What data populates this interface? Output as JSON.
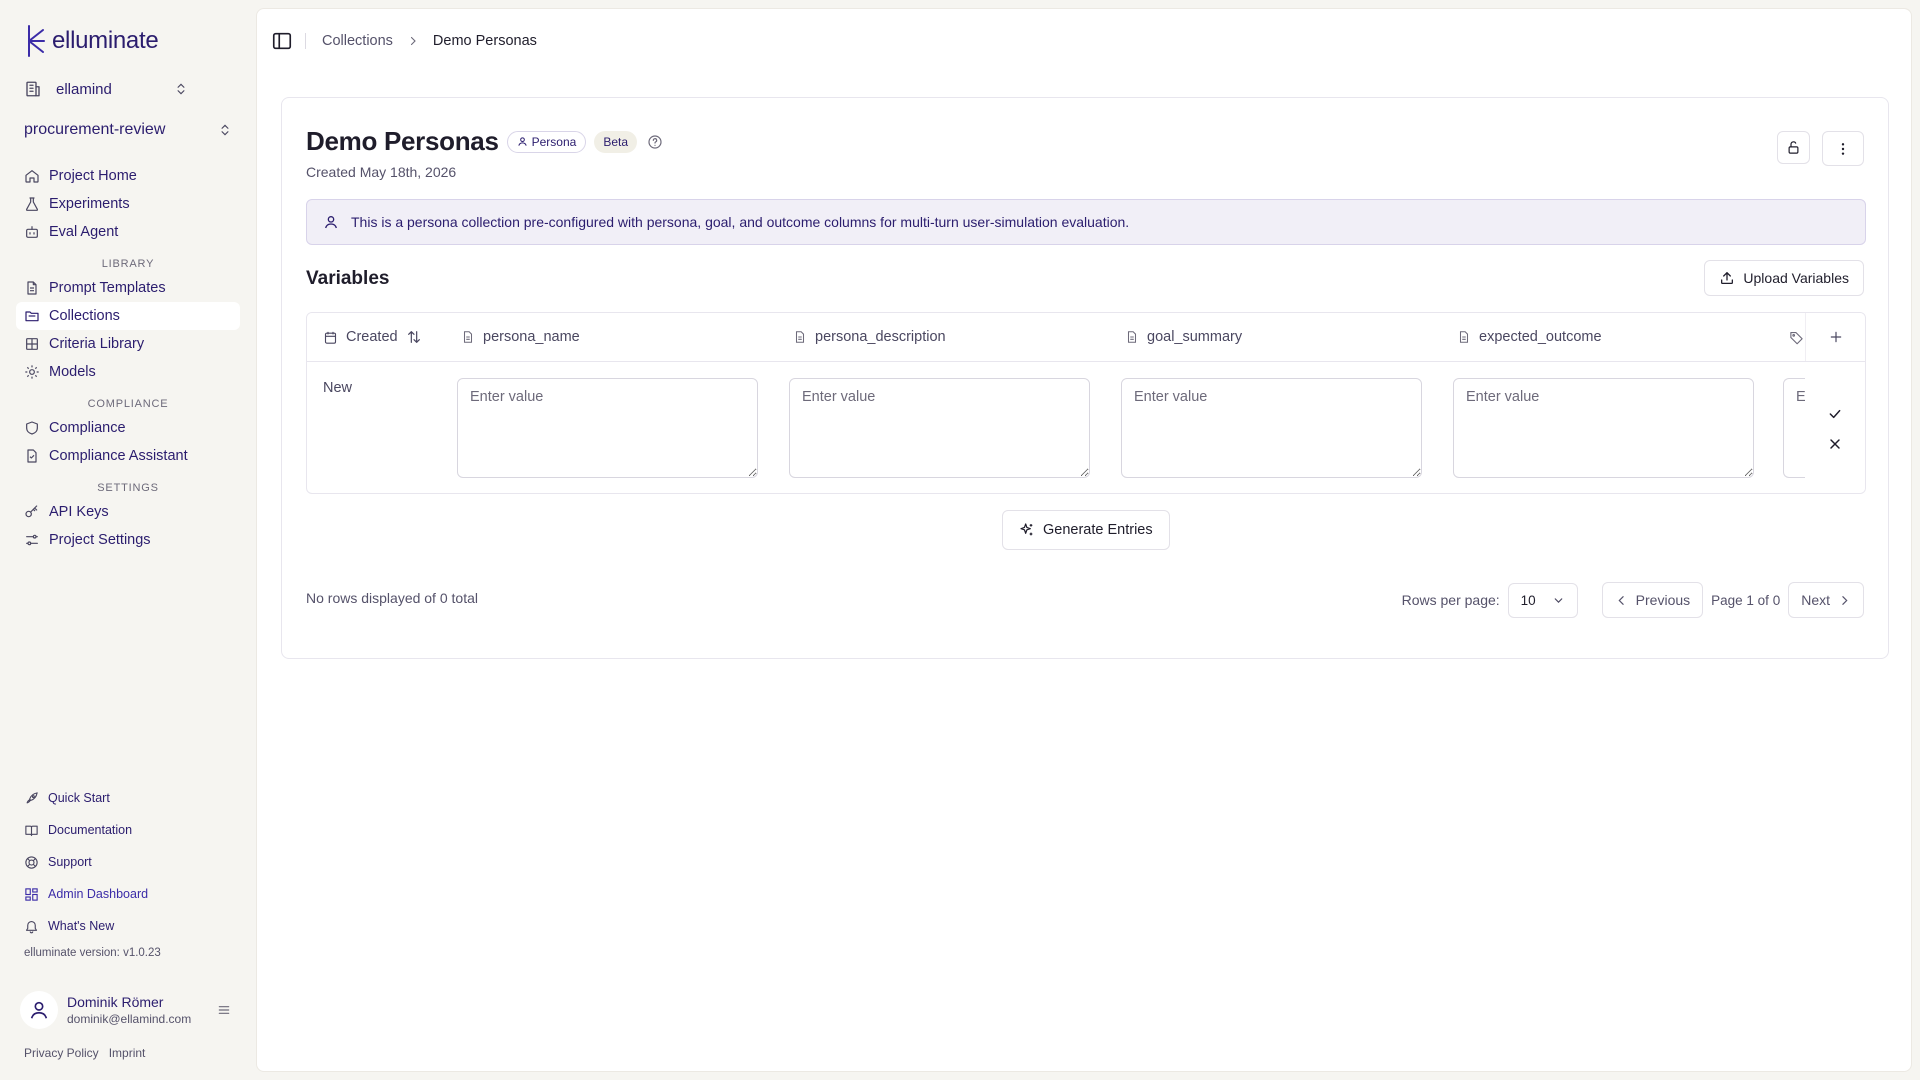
{
  "app": {
    "name": "elluminate",
    "version_text": "elluminate version: v1.0.23"
  },
  "org": {
    "name": "ellamind"
  },
  "project": {
    "name": "procurement-review"
  },
  "nav": {
    "main": [
      {
        "label": "Project Home",
        "icon": "home-icon"
      },
      {
        "label": "Experiments",
        "icon": "flask-icon"
      },
      {
        "label": "Eval Agent",
        "icon": "bot-icon"
      }
    ],
    "library_title": "LIBRARY",
    "library": [
      {
        "label": "Prompt Templates",
        "icon": "file-icon"
      },
      {
        "label": "Collections",
        "icon": "folder-icon",
        "active": true
      },
      {
        "label": "Criteria Library",
        "icon": "library-icon"
      },
      {
        "label": "Models",
        "icon": "cog-icon"
      }
    ],
    "compliance_title": "COMPLIANCE",
    "compliance": [
      {
        "label": "Compliance",
        "icon": "shield-icon"
      },
      {
        "label": "Compliance Assistant",
        "icon": "file-check-icon"
      }
    ],
    "settings_title": "SETTINGS",
    "settings": [
      {
        "label": "API Keys",
        "icon": "key-icon"
      },
      {
        "label": "Project Settings",
        "icon": "sliders-icon"
      }
    ]
  },
  "footer_nav": [
    {
      "label": "Quick Start",
      "icon": "rocket-icon"
    },
    {
      "label": "Documentation",
      "icon": "book-icon"
    },
    {
      "label": "Support",
      "icon": "lifebuoy-icon"
    },
    {
      "label": "Admin Dashboard",
      "icon": "grid-icon"
    },
    {
      "label": "What's New",
      "icon": "bell-icon"
    }
  ],
  "user": {
    "name": "Dominik Römer",
    "email": "dominik@ellamind.com"
  },
  "legal": {
    "privacy": "Privacy Policy",
    "imprint": "Imprint"
  },
  "breadcrumb": {
    "parent": "Collections",
    "current": "Demo Personas"
  },
  "collection": {
    "title": "Demo Personas",
    "type_badge": "Persona",
    "beta_badge": "Beta",
    "created": "Created May 18th, 2026",
    "info": "This is a persona collection pre-configured with persona, goal, and outcome columns for multi-turn user-simulation evaluation."
  },
  "variables": {
    "title": "Variables",
    "upload_label": "Upload Variables",
    "columns": [
      {
        "label": "Created",
        "icon": "calendar-icon"
      },
      {
        "label": "persona_name",
        "icon": "doc-icon"
      },
      {
        "label": "persona_description",
        "icon": "doc-icon"
      },
      {
        "label": "goal_summary",
        "icon": "doc-icon"
      },
      {
        "label": "expected_outcome",
        "icon": "doc-icon"
      }
    ],
    "new_row_label": "New",
    "input_placeholder": "Enter value",
    "clipped_placeholder": "E"
  },
  "generate_label": "Generate Entries",
  "pagination": {
    "status": "No rows displayed of 0 total",
    "rows_label": "Rows per page:",
    "rows_value": "10",
    "previous": "Previous",
    "page_info": "Page 1 of 0",
    "next": "Next"
  },
  "colors": {
    "brand": "#2b1d6e",
    "accent": "#3b2ca8",
    "banner_bg": "#f1eff7",
    "app_bg": "#f6f5f1"
  }
}
